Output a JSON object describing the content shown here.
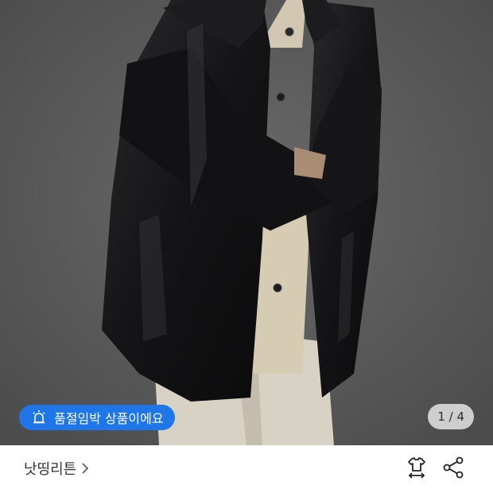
{
  "product_image": {
    "alt_icon": "product-photo",
    "counter": {
      "current": "1",
      "total": "4",
      "text": "1 / 4"
    }
  },
  "badge": {
    "icon": "alarm-icon",
    "text": "품절임박 상품이에요",
    "color": "#1f76e8"
  },
  "brand": {
    "name": "낫띵리튼",
    "chevron_icon": "chevron-right-icon"
  },
  "actions": {
    "size_icon": "size-guide-icon",
    "share_icon": "share-icon"
  }
}
